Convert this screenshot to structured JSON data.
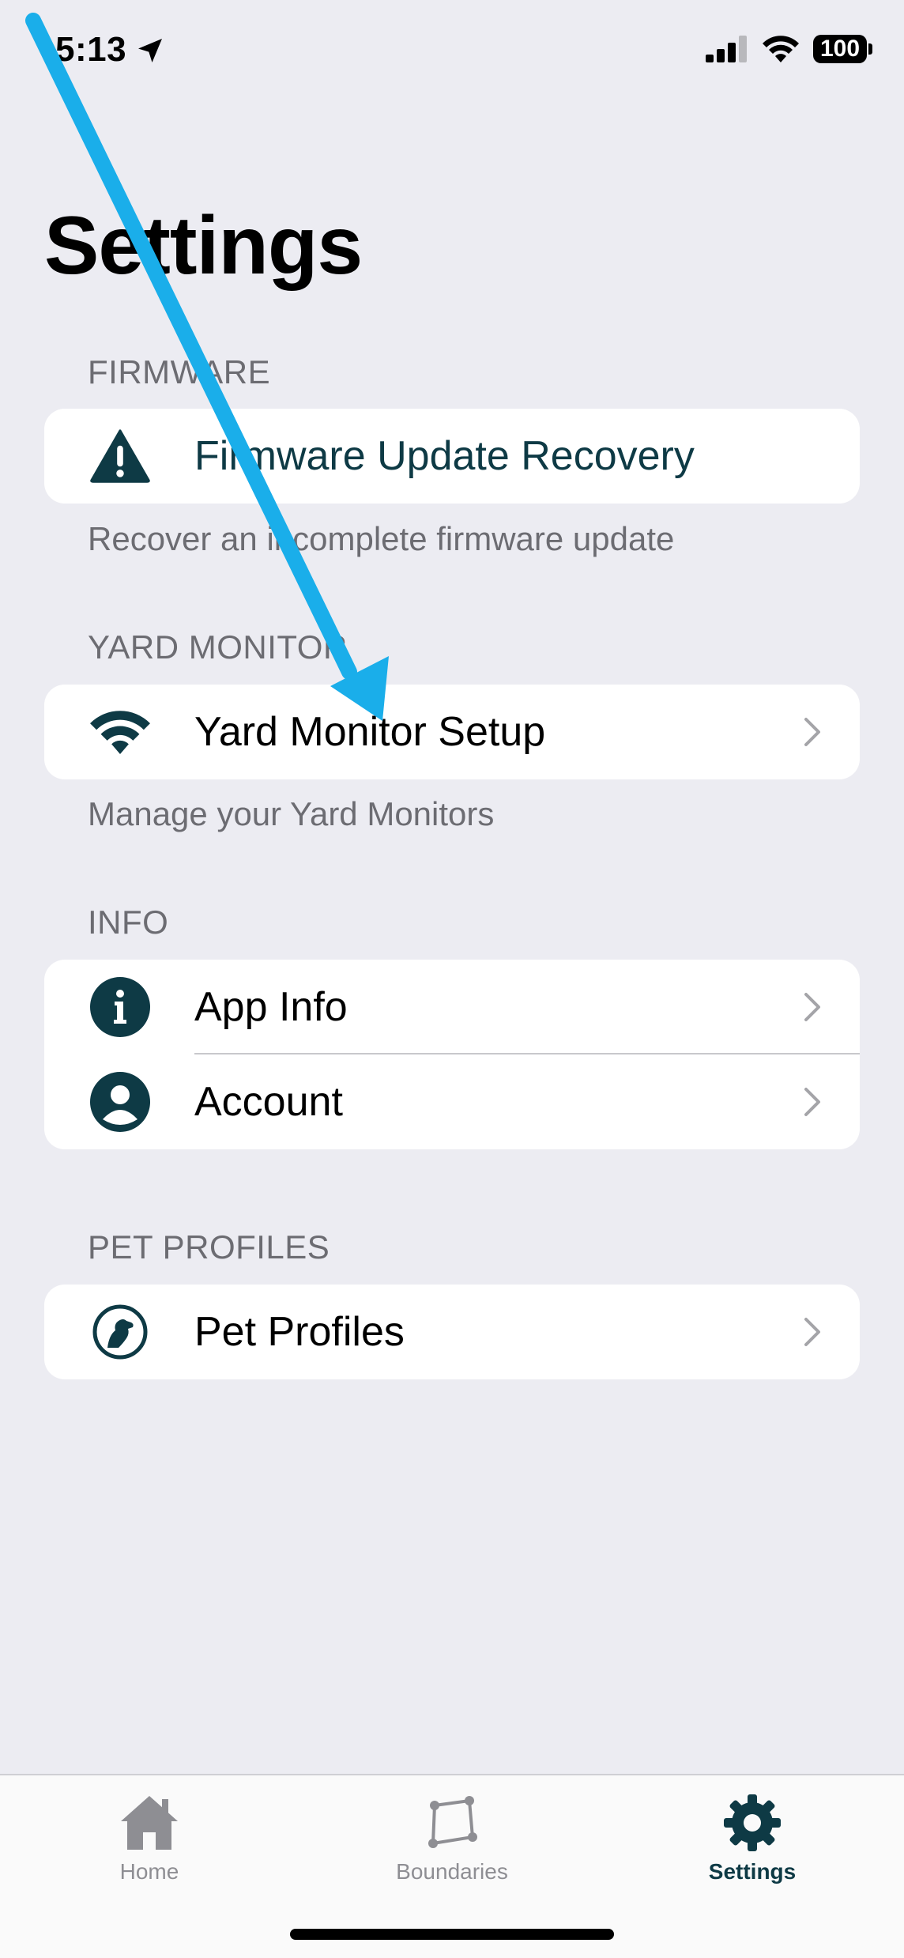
{
  "status_bar": {
    "time": "5:13",
    "battery": "100",
    "location_icon": "location-arrow-icon",
    "signal_icon": "cellular-signal-icon",
    "wifi_icon": "wifi-icon"
  },
  "page": {
    "title": "Settings"
  },
  "sections": {
    "firmware": {
      "header": "FIRMWARE",
      "items": [
        {
          "label": "Firmware Update Recovery",
          "icon": "warning-icon"
        }
      ],
      "footer": "Recover an incomplete firmware update"
    },
    "yard_monitor": {
      "header": "YARD MONITOR",
      "items": [
        {
          "label": "Yard Monitor Setup",
          "icon": "wifi-icon"
        }
      ],
      "footer": "Manage your Yard Monitors"
    },
    "info": {
      "header": "INFO",
      "items": [
        {
          "label": "App Info",
          "icon": "info-icon"
        },
        {
          "label": "Account",
          "icon": "person-icon"
        }
      ]
    },
    "pet_profiles": {
      "header": "PET PROFILES",
      "items": [
        {
          "label": "Pet Profiles",
          "icon": "dog-icon"
        }
      ]
    }
  },
  "tab_bar": {
    "tabs": [
      {
        "label": "Home",
        "icon": "home-icon",
        "active": false
      },
      {
        "label": "Boundaries",
        "icon": "boundary-icon",
        "active": false
      },
      {
        "label": "Settings",
        "icon": "gear-icon",
        "active": true
      }
    ]
  },
  "colors": {
    "background": "#ececf2",
    "accent": "#0e3a45",
    "annotation_arrow": "#1aaeea",
    "secondary_text": "#6c6c72"
  }
}
